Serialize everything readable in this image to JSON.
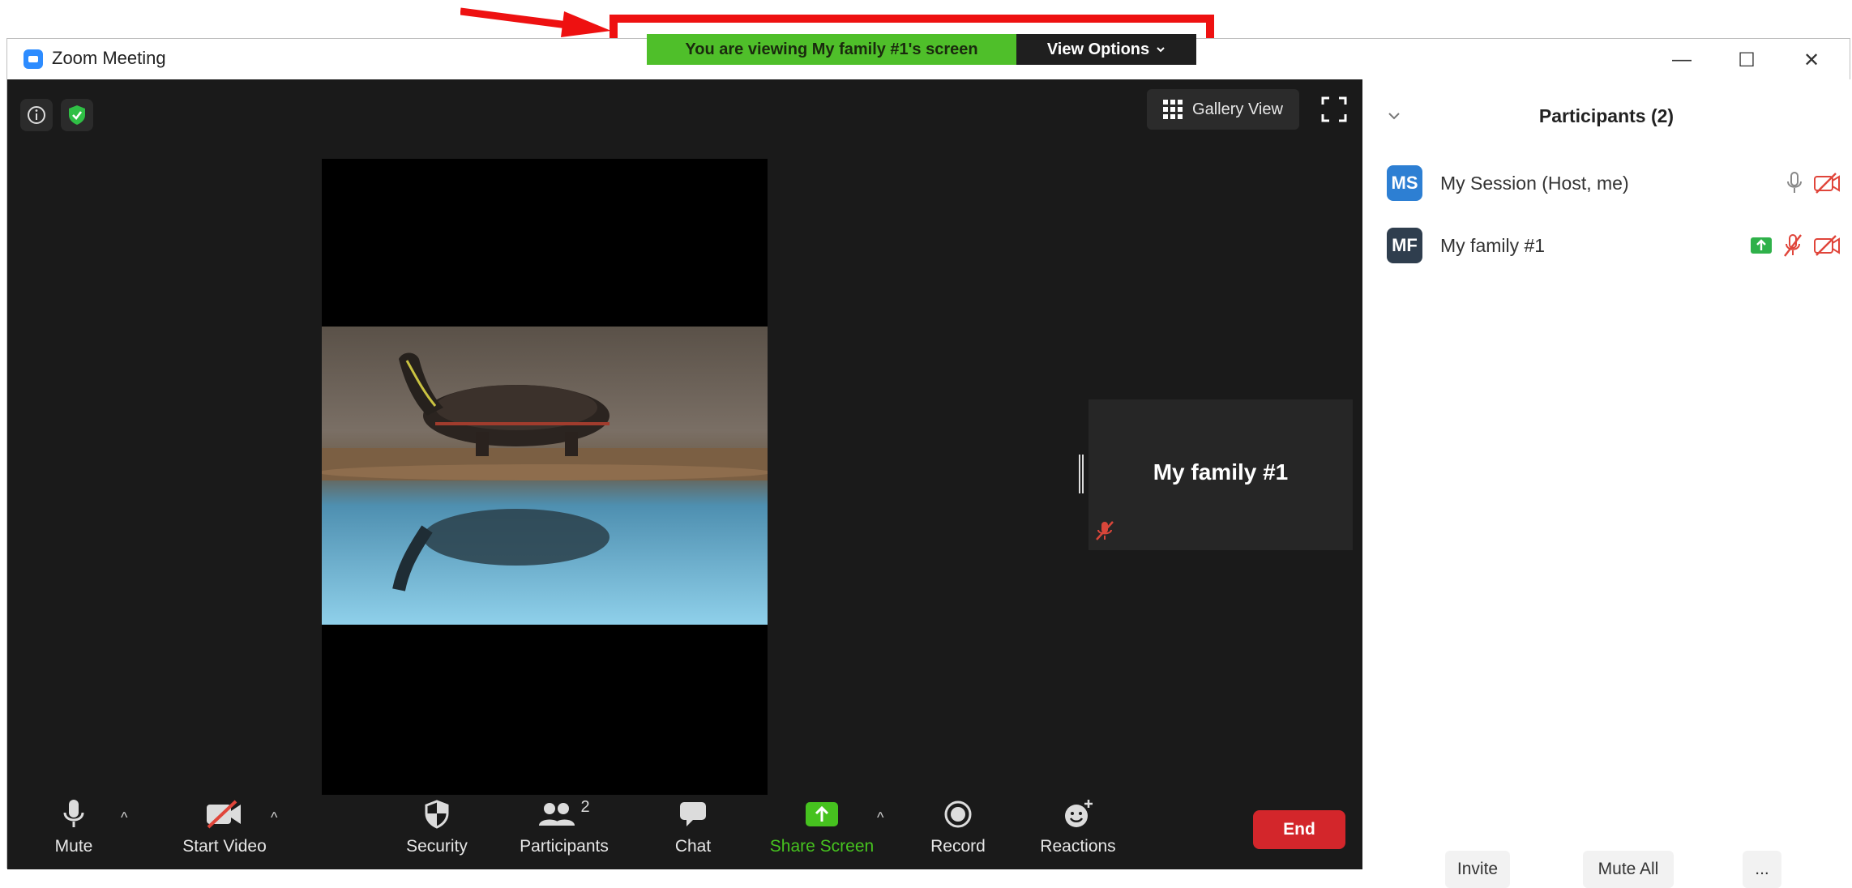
{
  "banner": {
    "message": "You are viewing My family #1's screen",
    "view_options": "View Options"
  },
  "window": {
    "title": "Zoom Meeting",
    "controls": {
      "minimize": "—",
      "maximize": "☐",
      "close": "✕"
    }
  },
  "video": {
    "gallery_view": "Gallery View",
    "tile_name": "My family #1"
  },
  "toolbar": {
    "mute": "Mute",
    "start_video": "Start Video",
    "security": "Security",
    "participants": "Participants",
    "participants_count": "2",
    "chat": "Chat",
    "share_screen": "Share Screen",
    "record": "Record",
    "reactions": "Reactions",
    "end": "End"
  },
  "panel": {
    "title": "Participants (2)",
    "participants": [
      {
        "initials": "MS",
        "name": "My Session (Host, me)",
        "avatar_color": "#2d7fd3"
      },
      {
        "initials": "MF",
        "name": "My family #1",
        "avatar_color": "#2f3e4e"
      }
    ],
    "invite": "Invite",
    "mute_all": "Mute All",
    "more": "..."
  },
  "colors": {
    "annotation_red": "#ee1111",
    "banner_green": "#4fbf2a",
    "share_green": "#46c21f",
    "end_red": "#d3262b"
  },
  "icons": [
    "info-icon",
    "shield-check-icon",
    "gallery-grid-icon",
    "fullscreen-icon",
    "microphone-icon",
    "video-off-icon",
    "security-shield-icon",
    "participants-icon",
    "chat-icon",
    "share-screen-icon",
    "record-icon",
    "reactions-icon",
    "sharing-icon",
    "mic-muted-icon"
  ]
}
